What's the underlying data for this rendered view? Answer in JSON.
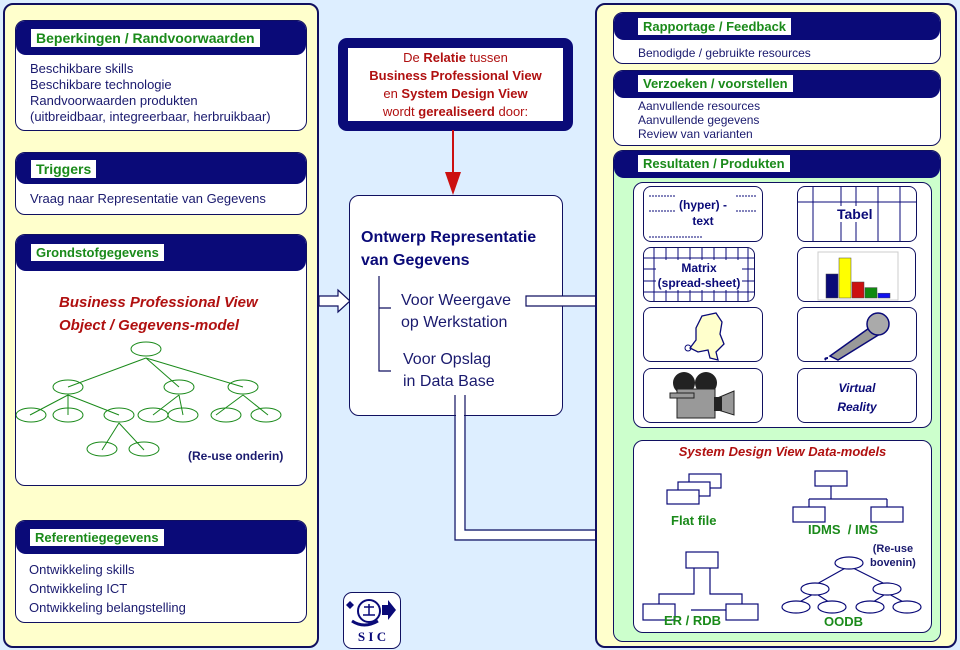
{
  "left": {
    "constraints": {
      "title": "Beperkingen / Randvoorwaarden",
      "lines": [
        "Beschikbare skills",
        "Beschikbare technologie",
        "Randvoorwaarden produkten",
        "(uitbreidbaar, integreerbaar, herbruikbaar)"
      ]
    },
    "triggers": {
      "title": "Triggers",
      "lines": [
        "Vraag naar Representatie van Gegevens"
      ]
    },
    "raw": {
      "title": "Grondstofgegevens",
      "line1": "Business Professional View",
      "line2": "Object / Gegevens-model",
      "note": "(Re-use onderin)"
    },
    "reference": {
      "title": "Referentiegegevens",
      "lines": [
        "Ontwikkeling skills",
        "Ontwikkeling ICT",
        "Ontwikkeling belangstelling"
      ]
    }
  },
  "center": {
    "relation": {
      "p1": "De ",
      "b1": "Relatie",
      "p2": " tussen",
      "b2": "Business Professional View",
      "p3": "en ",
      "b3": "System Design View",
      "p4": "wordt ",
      "b4": "gerealiseerd",
      "p5": " door:"
    },
    "design": {
      "title1": "Ontwerp Representatie",
      "title2": "van Gegevens",
      "opt1a": "Voor Weergave",
      "opt1b": "op Werkstation",
      "opt2a": "Voor Opslag",
      "opt2b": "in Data Base"
    },
    "logo": "S I C"
  },
  "right": {
    "report": {
      "title": "Rapportage / Feedback",
      "lines": [
        "Benodigde / gebruikte resources"
      ]
    },
    "requests": {
      "title": "Verzoeken / voorstellen",
      "lines": [
        "Aanvullende resources",
        "Aanvullende gegevens",
        "Review van varianten"
      ]
    },
    "results": {
      "title": "Resultaten / Produkten",
      "items": {
        "hypertext1": "(hyper) -",
        "hypertext2": "text",
        "table": "Tabel",
        "matrix1": "Matrix",
        "matrix2": "(spread-sheet)",
        "vr1": "Virtual",
        "vr2": "Reality"
      },
      "chart_icon": {
        "bars": [
          3,
          5,
          2,
          1.3,
          0.6
        ],
        "colors": [
          "#0a0a78",
          "#ffff00",
          "#cc1010",
          "#108a10",
          "#1010ee"
        ]
      }
    },
    "models": {
      "title": "System Design View Data-models",
      "flat": "Flat file",
      "idms": "IDMS  / IMS",
      "reuse1": "(Re-use",
      "reuse2": "bovenin)",
      "er": "ER / RDB",
      "oodb": "OODB"
    }
  }
}
